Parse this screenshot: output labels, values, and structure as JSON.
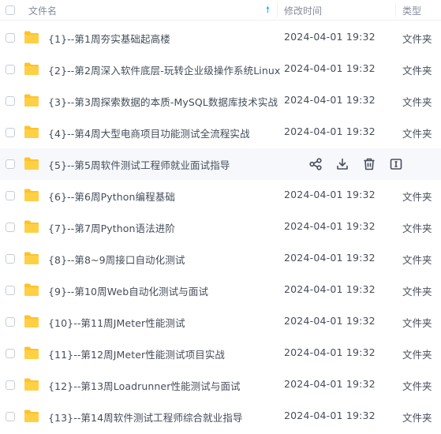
{
  "header": {
    "name_label": "文件名",
    "sort_icon": "arrow-up-icon",
    "time_label": "修改时间",
    "type_label": "类型"
  },
  "colors": {
    "folder": "#ffc22b",
    "accent": "#06a7ff",
    "hover_bg": "#f6f8fc"
  },
  "rows": [
    {
      "name": "{1}--第1周夯实基础起高楼",
      "time": "2024-04-01 19:32",
      "type": "文件夹"
    },
    {
      "name": "{2}--第2周深入软件底层-玩转企业级操作系统Linux",
      "time": "2024-04-01 19:32",
      "type": "文件夹"
    },
    {
      "name": "{3}--第3周探索数据的本质-MySQL数据库技术实战",
      "time": "2024-04-01 19:32",
      "type": "文件夹"
    },
    {
      "name": "{4}--第4周大型电商项目功能测试全流程实战",
      "time": "2024-04-01 19:32",
      "type": "文件夹"
    },
    {
      "name": "{5}--第5周软件测试工程师就业面试指导",
      "time": "",
      "type": "",
      "hovered": true,
      "actions": [
        "share-icon",
        "download-icon",
        "delete-icon",
        "rename-icon"
      ]
    },
    {
      "name": "{6}--第6周Python编程基础",
      "time": "2024-04-01 19:32",
      "type": "文件夹"
    },
    {
      "name": "{7}--第7周Python语法进阶",
      "time": "2024-04-01 19:32",
      "type": "文件夹"
    },
    {
      "name": "{8}--第8~9周接口自动化测试",
      "time": "2024-04-01 19:32",
      "type": "文件夹"
    },
    {
      "name": "{9}--第10周Web自动化测试与面试",
      "time": "2024-04-01 19:32",
      "type": "文件夹"
    },
    {
      "name": "{10}--第11周JMeter性能测试",
      "time": "2024-04-01 19:32",
      "type": "文件夹"
    },
    {
      "name": "{11}--第12周JMeter性能测试项目实战",
      "time": "2024-04-01 19:32",
      "type": "文件夹"
    },
    {
      "name": "{12}--第13周Loadrunner性能测试与面试",
      "time": "2024-04-01 19:32",
      "type": "文件夹"
    },
    {
      "name": "{13}--第14周软件测试工程师综合就业指导",
      "time": "2024-04-01 19:32",
      "type": "文件夹"
    }
  ]
}
